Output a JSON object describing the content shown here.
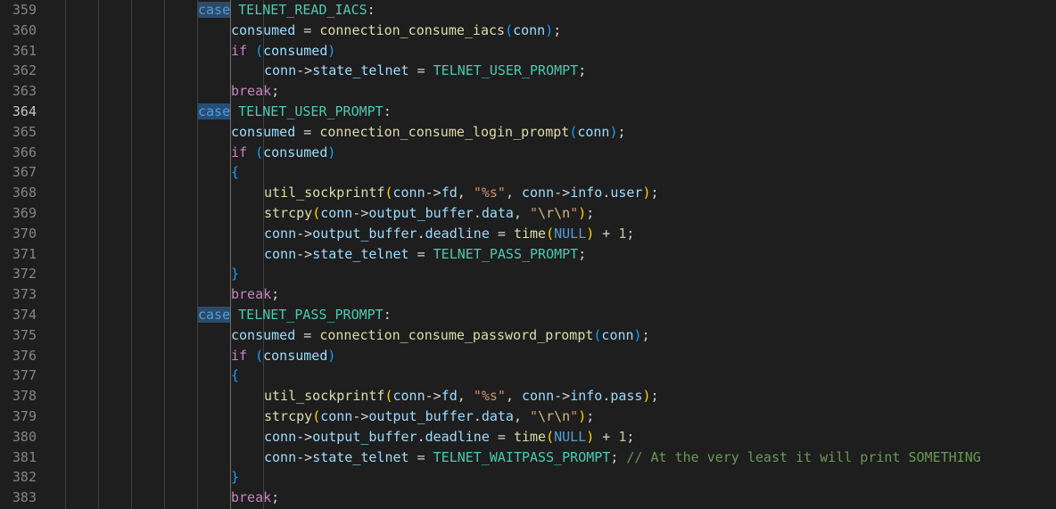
{
  "editor": {
    "lines": [
      {
        "num": "359",
        "tokens": [
          {
            "t": "case",
            "c": "kw case-hl"
          },
          {
            "t": " TELNET_READ_IACS",
            "c": "enum"
          },
          {
            "t": ":",
            "c": ""
          }
        ],
        "indent": 5
      },
      {
        "num": "360",
        "tokens": [
          {
            "t": "consumed",
            "c": "var"
          },
          {
            "t": " = ",
            "c": ""
          },
          {
            "t": "connection_consume_iacs",
            "c": "fn"
          },
          {
            "t": "(",
            "c": "p2"
          },
          {
            "t": "conn",
            "c": "var"
          },
          {
            "t": ")",
            "c": "p2"
          },
          {
            "t": ";",
            "c": ""
          }
        ],
        "indent": 6
      },
      {
        "num": "361",
        "tokens": [
          {
            "t": "if",
            "c": "ctrl"
          },
          {
            "t": " ",
            "c": ""
          },
          {
            "t": "(",
            "c": "p2"
          },
          {
            "t": "consumed",
            "c": "var"
          },
          {
            "t": ")",
            "c": "p2"
          }
        ],
        "indent": 6
      },
      {
        "num": "362",
        "tokens": [
          {
            "t": "conn",
            "c": "var"
          },
          {
            "t": "->",
            "c": ""
          },
          {
            "t": "state_telnet",
            "c": "var"
          },
          {
            "t": " = ",
            "c": ""
          },
          {
            "t": "TELNET_USER_PROMPT",
            "c": "enum"
          },
          {
            "t": ";",
            "c": ""
          }
        ],
        "indent": 7
      },
      {
        "num": "363",
        "tokens": [
          {
            "t": "break",
            "c": "ctrl"
          },
          {
            "t": ";",
            "c": ""
          }
        ],
        "indent": 6
      },
      {
        "num": "364",
        "tokens": [
          {
            "t": "case",
            "c": "kw hl"
          },
          {
            "t": " TELNET_USER_PROMPT",
            "c": "enum"
          },
          {
            "t": ":",
            "c": ""
          }
        ],
        "indent": 5,
        "active": true
      },
      {
        "num": "365",
        "tokens": [
          {
            "t": "consumed",
            "c": "var"
          },
          {
            "t": " = ",
            "c": ""
          },
          {
            "t": "connection_consume_login_prompt",
            "c": "fn"
          },
          {
            "t": "(",
            "c": "p2"
          },
          {
            "t": "conn",
            "c": "var"
          },
          {
            "t": ")",
            "c": "p2"
          },
          {
            "t": ";",
            "c": ""
          }
        ],
        "indent": 6
      },
      {
        "num": "366",
        "tokens": [
          {
            "t": "if",
            "c": "ctrl"
          },
          {
            "t": " ",
            "c": ""
          },
          {
            "t": "(",
            "c": "p2"
          },
          {
            "t": "consumed",
            "c": "var"
          },
          {
            "t": ")",
            "c": "p2"
          }
        ],
        "indent": 6
      },
      {
        "num": "367",
        "tokens": [
          {
            "t": "{",
            "c": "p2"
          }
        ],
        "indent": 6
      },
      {
        "num": "368",
        "tokens": [
          {
            "t": "util_sockprintf",
            "c": "fn"
          },
          {
            "t": "(",
            "c": "p0"
          },
          {
            "t": "conn",
            "c": "var"
          },
          {
            "t": "->",
            "c": ""
          },
          {
            "t": "fd",
            "c": "var"
          },
          {
            "t": ", ",
            "c": ""
          },
          {
            "t": "\"%s\"",
            "c": "str"
          },
          {
            "t": ", ",
            "c": ""
          },
          {
            "t": "conn",
            "c": "var"
          },
          {
            "t": "->",
            "c": ""
          },
          {
            "t": "info",
            "c": "var"
          },
          {
            "t": ".",
            "c": ""
          },
          {
            "t": "user",
            "c": "var"
          },
          {
            "t": ")",
            "c": "p0"
          },
          {
            "t": ";",
            "c": ""
          }
        ],
        "indent": 7
      },
      {
        "num": "369",
        "tokens": [
          {
            "t": "strcpy",
            "c": "fn"
          },
          {
            "t": "(",
            "c": "p0"
          },
          {
            "t": "conn",
            "c": "var"
          },
          {
            "t": "->",
            "c": ""
          },
          {
            "t": "output_buffer",
            "c": "var"
          },
          {
            "t": ".",
            "c": ""
          },
          {
            "t": "data",
            "c": "var"
          },
          {
            "t": ", ",
            "c": ""
          },
          {
            "t": "\"",
            "c": "str"
          },
          {
            "t": "\\r\\n",
            "c": "esc"
          },
          {
            "t": "\"",
            "c": "str"
          },
          {
            "t": ")",
            "c": "p0"
          },
          {
            "t": ";",
            "c": ""
          }
        ],
        "indent": 7
      },
      {
        "num": "370",
        "tokens": [
          {
            "t": "conn",
            "c": "var"
          },
          {
            "t": "->",
            "c": ""
          },
          {
            "t": "output_buffer",
            "c": "var"
          },
          {
            "t": ".",
            "c": ""
          },
          {
            "t": "deadline",
            "c": "var"
          },
          {
            "t": " = ",
            "c": ""
          },
          {
            "t": "time",
            "c": "fn"
          },
          {
            "t": "(",
            "c": "p0"
          },
          {
            "t": "NULL",
            "c": "kw"
          },
          {
            "t": ")",
            "c": "p0"
          },
          {
            "t": " + ",
            "c": ""
          },
          {
            "t": "1",
            "c": "num"
          },
          {
            "t": ";",
            "c": ""
          }
        ],
        "indent": 7
      },
      {
        "num": "371",
        "tokens": [
          {
            "t": "conn",
            "c": "var"
          },
          {
            "t": "->",
            "c": ""
          },
          {
            "t": "state_telnet",
            "c": "var"
          },
          {
            "t": " = ",
            "c": ""
          },
          {
            "t": "TELNET_PASS_PROMPT",
            "c": "enum"
          },
          {
            "t": ";",
            "c": ""
          }
        ],
        "indent": 7
      },
      {
        "num": "372",
        "tokens": [
          {
            "t": "}",
            "c": "p2"
          }
        ],
        "indent": 6
      },
      {
        "num": "373",
        "tokens": [
          {
            "t": "break",
            "c": "ctrl"
          },
          {
            "t": ";",
            "c": ""
          }
        ],
        "indent": 6
      },
      {
        "num": "374",
        "tokens": [
          {
            "t": "case",
            "c": "kw case-hl"
          },
          {
            "t": " TELNET_PASS_PROMPT",
            "c": "enum"
          },
          {
            "t": ":",
            "c": ""
          }
        ],
        "indent": 5
      },
      {
        "num": "375",
        "tokens": [
          {
            "t": "consumed",
            "c": "var"
          },
          {
            "t": " = ",
            "c": ""
          },
          {
            "t": "connection_consume_password_prompt",
            "c": "fn"
          },
          {
            "t": "(",
            "c": "p2"
          },
          {
            "t": "conn",
            "c": "var"
          },
          {
            "t": ")",
            "c": "p2"
          },
          {
            "t": ";",
            "c": ""
          }
        ],
        "indent": 6
      },
      {
        "num": "376",
        "tokens": [
          {
            "t": "if",
            "c": "ctrl"
          },
          {
            "t": " ",
            "c": ""
          },
          {
            "t": "(",
            "c": "p2"
          },
          {
            "t": "consumed",
            "c": "var"
          },
          {
            "t": ")",
            "c": "p2"
          }
        ],
        "indent": 6
      },
      {
        "num": "377",
        "tokens": [
          {
            "t": "{",
            "c": "p2"
          }
        ],
        "indent": 6
      },
      {
        "num": "378",
        "tokens": [
          {
            "t": "util_sockprintf",
            "c": "fn"
          },
          {
            "t": "(",
            "c": "p0"
          },
          {
            "t": "conn",
            "c": "var"
          },
          {
            "t": "->",
            "c": ""
          },
          {
            "t": "fd",
            "c": "var"
          },
          {
            "t": ", ",
            "c": ""
          },
          {
            "t": "\"%s\"",
            "c": "str"
          },
          {
            "t": ", ",
            "c": ""
          },
          {
            "t": "conn",
            "c": "var"
          },
          {
            "t": "->",
            "c": ""
          },
          {
            "t": "info",
            "c": "var"
          },
          {
            "t": ".",
            "c": ""
          },
          {
            "t": "pass",
            "c": "var"
          },
          {
            "t": ")",
            "c": "p0"
          },
          {
            "t": ";",
            "c": ""
          }
        ],
        "indent": 7
      },
      {
        "num": "379",
        "tokens": [
          {
            "t": "strcpy",
            "c": "fn"
          },
          {
            "t": "(",
            "c": "p0"
          },
          {
            "t": "conn",
            "c": "var"
          },
          {
            "t": "->",
            "c": ""
          },
          {
            "t": "output_buffer",
            "c": "var"
          },
          {
            "t": ".",
            "c": ""
          },
          {
            "t": "data",
            "c": "var"
          },
          {
            "t": ", ",
            "c": ""
          },
          {
            "t": "\"",
            "c": "str"
          },
          {
            "t": "\\r\\n",
            "c": "esc"
          },
          {
            "t": "\"",
            "c": "str"
          },
          {
            "t": ")",
            "c": "p0"
          },
          {
            "t": ";",
            "c": ""
          }
        ],
        "indent": 7
      },
      {
        "num": "380",
        "tokens": [
          {
            "t": "conn",
            "c": "var"
          },
          {
            "t": "->",
            "c": ""
          },
          {
            "t": "output_buffer",
            "c": "var"
          },
          {
            "t": ".",
            "c": ""
          },
          {
            "t": "deadline",
            "c": "var"
          },
          {
            "t": " = ",
            "c": ""
          },
          {
            "t": "time",
            "c": "fn"
          },
          {
            "t": "(",
            "c": "p0"
          },
          {
            "t": "NULL",
            "c": "kw"
          },
          {
            "t": ")",
            "c": "p0"
          },
          {
            "t": " + ",
            "c": ""
          },
          {
            "t": "1",
            "c": "num"
          },
          {
            "t": ";",
            "c": ""
          }
        ],
        "indent": 7
      },
      {
        "num": "381",
        "tokens": [
          {
            "t": "conn",
            "c": "var"
          },
          {
            "t": "->",
            "c": ""
          },
          {
            "t": "state_telnet",
            "c": "var"
          },
          {
            "t": " = ",
            "c": ""
          },
          {
            "t": "TELNET_WAITPASS_PROMPT",
            "c": "enum"
          },
          {
            "t": "; ",
            "c": ""
          },
          {
            "t": "// At the very least it will print SOMETHING",
            "c": "com"
          }
        ],
        "indent": 7
      },
      {
        "num": "382",
        "tokens": [
          {
            "t": "}",
            "c": "p2"
          }
        ],
        "indent": 6
      },
      {
        "num": "383",
        "tokens": [
          {
            "t": "break",
            "c": "ctrl"
          },
          {
            "t": ";",
            "c": ""
          }
        ],
        "indent": 6
      }
    ],
    "active_line": "364"
  }
}
